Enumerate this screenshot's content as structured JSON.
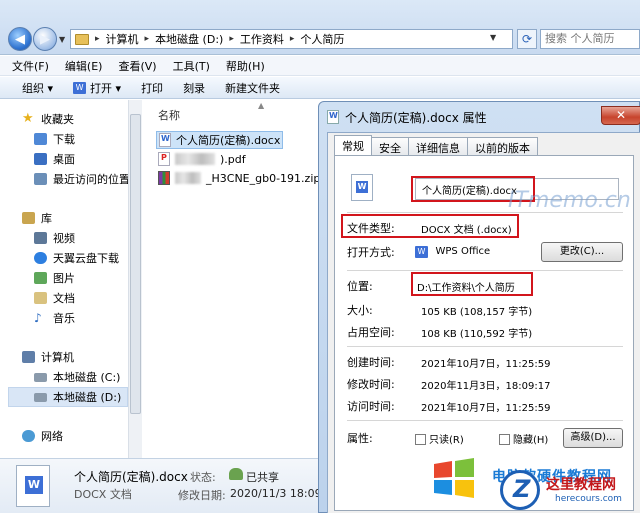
{
  "address_bar": {
    "crumbs": [
      "计算机",
      "本地磁盘 (D:)",
      "工作资料",
      "个人简历"
    ],
    "search_placeholder": "搜索 个人简历"
  },
  "menubar": [
    "文件(F)",
    "编辑(E)",
    "查看(V)",
    "工具(T)",
    "帮助(H)"
  ],
  "toolbar": {
    "organize": "组织 ▾",
    "open": "打开 ▾",
    "print": "打印",
    "burn": "刻录",
    "new_folder": "新建文件夹"
  },
  "sidebar": {
    "favorites": "收藏夹",
    "downloads": "下载",
    "desktop": "桌面",
    "recent": "最近访问的位置",
    "libraries": "库",
    "videos": "视频",
    "tianyi": "天翼云盘下载",
    "pictures": "图片",
    "documents": "文档",
    "music": "音乐",
    "computer": "计算机",
    "disk_c": "本地磁盘 (C:)",
    "disk_d": "本地磁盘 (D:)",
    "network": "网络"
  },
  "filelist": {
    "column_name": "名称",
    "files": [
      {
        "name": "个人简历(定稿).docx"
      },
      {
        "name": ").pdf"
      },
      {
        "name": "_H3CNE_gb0-191.zip"
      }
    ]
  },
  "details": {
    "name": "个人简历(定稿).docx",
    "type": "DOCX 文档",
    "state_label": "状态:",
    "state_value": "已共享",
    "modified_label": "修改日期:",
    "modified_value": "2020/11/3 18:09"
  },
  "properties": {
    "title": "个人简历(定稿).docx 属性",
    "close": "✕",
    "tabs": [
      "常规",
      "安全",
      "详细信息",
      "以前的版本"
    ],
    "filename": "个人简历(定稿).docx",
    "type_label": "文件类型:",
    "type_value": "DOCX 文档 (.docx)",
    "open_with_label": "打开方式:",
    "open_with_value": "WPS Office",
    "change_button": "更改(C)...",
    "location_label": "位置:",
    "location_value": "D:\\工作资料\\个人简历",
    "size_label": "大小:",
    "size_value": "105 KB (108,157 字节)",
    "disk_size_label": "占用空间:",
    "disk_size_value": "108 KB (110,592 字节)",
    "created_label": "创建时间:",
    "created_value": "2021年10月7日，11:25:59",
    "modified_label": "修改时间:",
    "modified_value": "2020年11月3日，18:09:17",
    "accessed_label": "访问时间:",
    "accessed_value": "2021年10月7日，11:25:59",
    "attributes_label": "属性:",
    "readonly_label": "只读(R)",
    "hidden_label": "隐藏(H)",
    "advanced_button": "高级(D)..."
  },
  "watermarks": {
    "itmemo": "ITmemo.cn",
    "brand_cn": "这里教程网",
    "brand_url": "herecours.com",
    "blue_text": "电脑软硬件教程网"
  },
  "colors": {
    "highlight_box": "#d2151c",
    "accent": "#3d6fd6"
  }
}
